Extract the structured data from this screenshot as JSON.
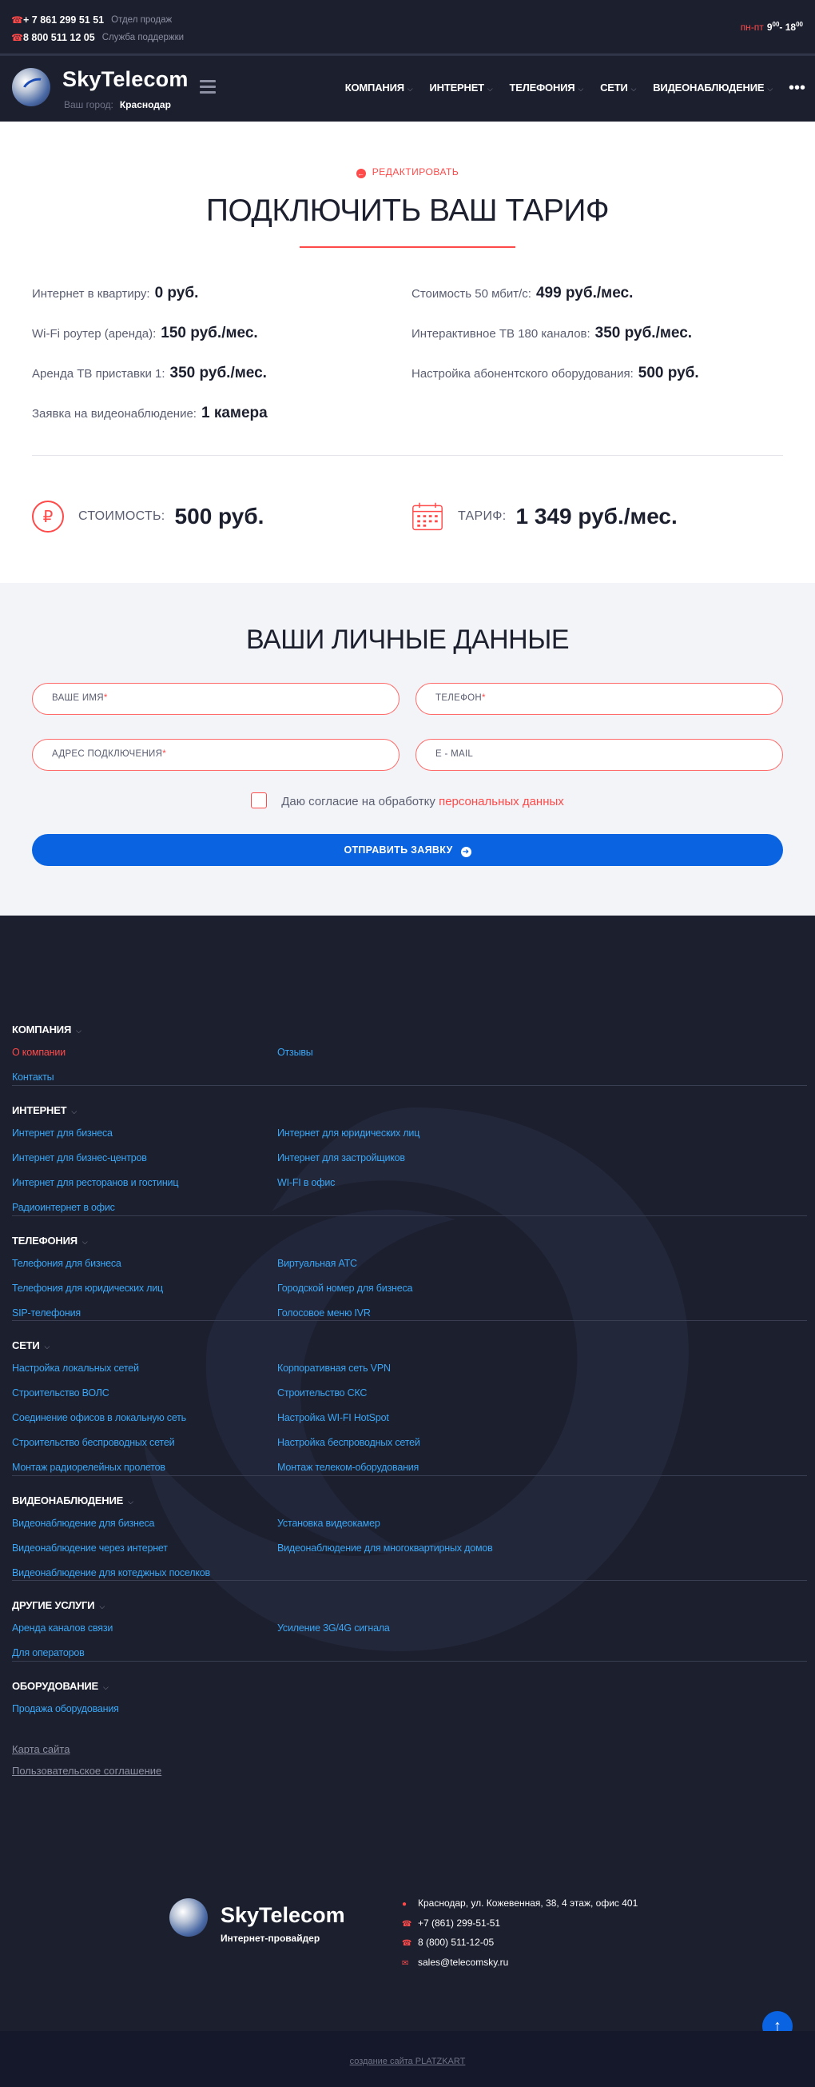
{
  "topbar": {
    "phones": [
      {
        "number": "+ 7 861 299 51 51",
        "desc": "Отдел продаж"
      },
      {
        "number": "8 800 511 12 05",
        "desc": "Служба поддержки"
      }
    ],
    "hours_days": "пн-пт",
    "hours_from": "9",
    "hours_from_sup": "00",
    "hours_to": "- 18",
    "hours_to_sup": "00"
  },
  "header": {
    "logo": "SkyTelecom",
    "city_label": "Ваш город:",
    "city": "Краснодар",
    "nav": [
      "КОМПАНИЯ",
      "ИНТЕРНЕТ",
      "ТЕЛЕФОНИЯ",
      "СЕТИ",
      "ВИДЕОНАБЛЮДЕНИЕ"
    ],
    "more": "•••"
  },
  "tariff": {
    "edit": "РЕДАКТИРОВАТЬ",
    "title": "ПОДКЛЮЧИТЬ ВАШ ТАРИФ",
    "items": [
      {
        "label": "Интернет в квартиру:",
        "value": "0 руб."
      },
      {
        "label": "Стоимость 50 мбит/с:",
        "value": "499 руб./мес."
      },
      {
        "label": "Wi-Fi роутер (аренда):",
        "value": "150 руб./мес."
      },
      {
        "label": "Интерактивное ТВ 180 каналов:",
        "value": "350 руб./мес."
      },
      {
        "label": "Аренда ТВ приставки 1:",
        "value": "350 руб./мес."
      },
      {
        "label": "Настройка абонентского оборудования:",
        "value": "500 руб."
      },
      {
        "label": "Заявка на видеонаблюдение:",
        "value": "1 камера"
      }
    ],
    "cost_label": "СТОИМОСТЬ:",
    "cost_value": "500 руб.",
    "tariff_label": "ТАРИФ:",
    "tariff_value": "1 349 руб./мес."
  },
  "form": {
    "title": "ВАШИ ЛИЧНЫЕ ДАННЫЕ",
    "name": "ВАШЕ ИМЯ",
    "phone": "ТЕЛЕФОН",
    "address": "АДРЕС ПОДКЛЮЧЕНИЯ",
    "email": "E - MAIL",
    "required_mark": "*",
    "consent": "Даю согласие на обработку",
    "consent_link": "персональных данных",
    "submit": "ОТПРАВИТЬ ЗАЯВКУ"
  },
  "footer": {
    "sections": [
      {
        "title": "КОМПАНИЯ",
        "links": [
          "О компании",
          "Отзывы",
          "Контакты"
        ]
      },
      {
        "title": "ИНТЕРНЕТ",
        "links": [
          "Интернет для бизнеса",
          "Интернет для юридических лиц",
          "Интернет для бизнес-центров",
          "Интернет для застройщиков",
          "Интернет для ресторанов и гостиниц",
          "WI-FI в офис",
          "Радиоинтернет в офис"
        ]
      },
      {
        "title": "ТЕЛЕФОНИЯ",
        "links": [
          "Телефония для бизнеса",
          "Виртуальная АТС",
          "Телефония для юридических лиц",
          "Городской номер для бизнеса",
          "SIP-телефония",
          "Голосовое меню IVR"
        ]
      },
      {
        "title": "СЕТИ",
        "links": [
          "Настройка локальных сетей",
          "Корпоративная сеть VPN",
          "Строительство ВОЛС",
          "Строительство СКС",
          "Соединение офисов в локальную сеть",
          "Настройка WI-FI HotSpot",
          "Строительство беспроводных сетей",
          "Настройка беспроводных сетей",
          "Монтаж радиорелейных пролетов",
          "Монтаж телеком-оборудования"
        ]
      },
      {
        "title": "ВИДЕОНАБЛЮДЕНИЕ",
        "links": [
          "Видеонаблюдение для бизнеса",
          "Установка видеокамер",
          "Видеонаблюдение через интернет",
          "Видеонаблюдение для многоквартирных домов",
          "Видеонаблюдение для котеджных поселков"
        ]
      },
      {
        "title": "ДРУГИЕ УСЛУГИ",
        "links": [
          "Аренда каналов связи",
          "Усиление 3G/4G сигнала",
          "Для операторов"
        ]
      },
      {
        "title": "ОБОРУДОВАНИЕ",
        "links": [
          "Продажа оборудования"
        ]
      }
    ],
    "sitemap": "Карта сайта",
    "agreement": "Пользовательское соглашение",
    "logo": "SkyTelecom",
    "logo_sub": "Интернет-провайдер",
    "address": "Краснодар, ул. Кожевенная, 38, 4 этаж, офис 401",
    "phone1": "+7 (861) 299-51-51",
    "phone2": "8 (800) 511-12-05",
    "email": "sales@telecomsky.ru",
    "made_by": "создание сайта PLATZKART"
  }
}
